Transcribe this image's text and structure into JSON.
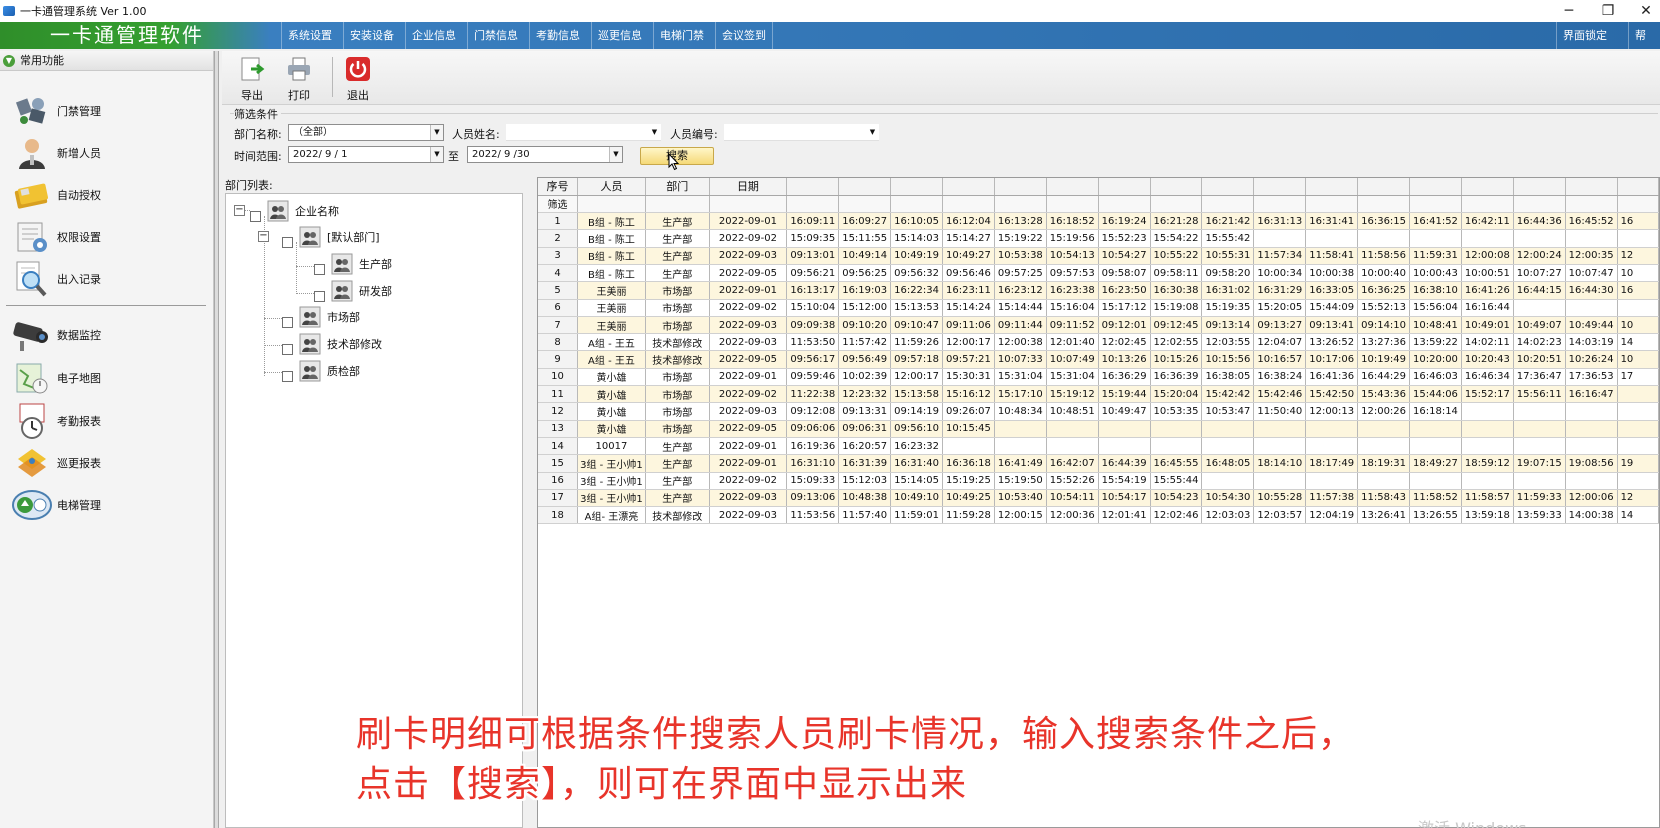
{
  "window": {
    "title": "一卡通管理系统  Ver 1.00",
    "controls": {
      "minimize": "─",
      "restore": "❐",
      "close": "✕"
    }
  },
  "menubar": {
    "brand": "一卡通管理软件",
    "items": [
      "系统设置",
      "安装设备",
      "企业信息",
      "门禁信息",
      "考勤信息",
      "巡更信息",
      "电梯门禁",
      "会议签到"
    ],
    "right_items": [
      "界面锁定",
      "帮助"
    ]
  },
  "sidebar": {
    "header": "常用功能",
    "group1": [
      {
        "label": "门禁管理",
        "icon": "door-access-icon"
      },
      {
        "label": "新增人员",
        "icon": "person-icon"
      },
      {
        "label": "自动授权",
        "icon": "card-icon"
      },
      {
        "label": "权限设置",
        "icon": "permission-icon"
      },
      {
        "label": "出入记录",
        "icon": "record-search-icon"
      }
    ],
    "group2": [
      {
        "label": "数据监控",
        "icon": "camera-icon"
      },
      {
        "label": "电子地图",
        "icon": "map-icon"
      },
      {
        "label": "考勤报表",
        "icon": "clock-icon"
      },
      {
        "label": "巡更报表",
        "icon": "patrol-icon"
      },
      {
        "label": "电梯管理",
        "icon": "elevator-icon"
      }
    ]
  },
  "toolbar": {
    "export": "导出",
    "print": "打印",
    "exit": "退出"
  },
  "filter": {
    "legend": "筛选条件",
    "dept_label": "部门名称:",
    "dept_value": "（全部）",
    "name_label": "人员姓名:",
    "name_value": "",
    "id_label": "人员编号:",
    "id_value": "",
    "time_label": "时间范围:",
    "date_from": "2022/ 9 / 1",
    "to_label": "至",
    "date_to": "2022/ 9 /30",
    "search_button": "搜索"
  },
  "dept_tree": {
    "label": "部门列表:",
    "root": "企业名称",
    "nodes": [
      "[默认部门]",
      "生产部",
      "研发部",
      "市场部",
      "技术部修改",
      "质检部"
    ]
  },
  "grid": {
    "headers": [
      "序号",
      "人员",
      "部门",
      "日期"
    ],
    "filter_row_label": "筛选",
    "rows": [
      {
        "no": "1",
        "person": "B组 - 陈工",
        "dept": "生产部",
        "date": "2022-09-01",
        "times": [
          "16:09:11",
          "16:09:27",
          "16:10:05",
          "16:12:04",
          "16:13:28",
          "16:18:52",
          "16:19:24",
          "16:21:28",
          "16:21:42",
          "16:31:13",
          "16:31:41",
          "16:36:15",
          "16:41:52",
          "16:42:11",
          "16:44:36",
          "16:45:52",
          "16"
        ]
      },
      {
        "no": "2",
        "person": "B组 - 陈工",
        "dept": "生产部",
        "date": "2022-09-02",
        "times": [
          "15:09:35",
          "15:11:55",
          "15:14:03",
          "15:14:27",
          "15:19:22",
          "15:19:56",
          "15:52:23",
          "15:54:22",
          "15:55:42"
        ]
      },
      {
        "no": "3",
        "person": "B组 - 陈工",
        "dept": "生产部",
        "date": "2022-09-03",
        "times": [
          "09:13:01",
          "10:49:14",
          "10:49:19",
          "10:49:27",
          "10:53:38",
          "10:54:13",
          "10:54:27",
          "10:55:22",
          "10:55:31",
          "11:57:34",
          "11:58:41",
          "11:58:56",
          "11:59:31",
          "12:00:08",
          "12:00:24",
          "12:00:35",
          "12"
        ]
      },
      {
        "no": "4",
        "person": "B组 - 陈工",
        "dept": "生产部",
        "date": "2022-09-05",
        "times": [
          "09:56:21",
          "09:56:25",
          "09:56:32",
          "09:56:46",
          "09:57:25",
          "09:57:53",
          "09:58:07",
          "09:58:11",
          "09:58:20",
          "10:00:34",
          "10:00:38",
          "10:00:40",
          "10:00:43",
          "10:00:51",
          "10:07:27",
          "10:07:47",
          "10"
        ]
      },
      {
        "no": "5",
        "person": "王美丽",
        "dept": "市场部",
        "date": "2022-09-01",
        "times": [
          "16:13:17",
          "16:19:03",
          "16:22:34",
          "16:23:11",
          "16:23:12",
          "16:23:38",
          "16:23:50",
          "16:30:38",
          "16:31:02",
          "16:31:29",
          "16:33:05",
          "16:36:25",
          "16:38:10",
          "16:41:26",
          "16:44:15",
          "16:44:30",
          "16"
        ]
      },
      {
        "no": "6",
        "person": "王美丽",
        "dept": "市场部",
        "date": "2022-09-02",
        "times": [
          "15:10:04",
          "15:12:00",
          "15:13:53",
          "15:14:24",
          "15:14:44",
          "15:16:04",
          "15:17:12",
          "15:19:08",
          "15:19:35",
          "15:20:05",
          "15:44:09",
          "15:52:13",
          "15:56:04",
          "16:16:44"
        ]
      },
      {
        "no": "7",
        "person": "王美丽",
        "dept": "市场部",
        "date": "2022-09-03",
        "times": [
          "09:09:38",
          "09:10:20",
          "09:10:47",
          "09:11:06",
          "09:11:44",
          "09:11:52",
          "09:12:01",
          "09:12:45",
          "09:13:14",
          "09:13:27",
          "09:13:41",
          "09:14:10",
          "10:48:41",
          "10:49:01",
          "10:49:07",
          "10:49:44",
          "10"
        ]
      },
      {
        "no": "8",
        "person": "A组 - 王五",
        "dept": "技术部修改",
        "date": "2022-09-03",
        "times": [
          "11:53:50",
          "11:57:42",
          "11:59:26",
          "12:00:17",
          "12:00:38",
          "12:01:40",
          "12:02:45",
          "12:02:55",
          "12:03:55",
          "12:04:07",
          "13:26:52",
          "13:27:36",
          "13:59:22",
          "14:02:11",
          "14:02:23",
          "14:03:19",
          "14"
        ]
      },
      {
        "no": "9",
        "person": "A组 - 王五",
        "dept": "技术部修改",
        "date": "2022-09-05",
        "times": [
          "09:56:17",
          "09:56:49",
          "09:57:18",
          "09:57:21",
          "10:07:33",
          "10:07:49",
          "10:13:26",
          "10:15:26",
          "10:15:56",
          "10:16:57",
          "10:17:06",
          "10:19:49",
          "10:20:00",
          "10:20:43",
          "10:20:51",
          "10:26:24",
          "10"
        ]
      },
      {
        "no": "10",
        "person": "黄小雄",
        "dept": "市场部",
        "date": "2022-09-01",
        "times": [
          "09:59:46",
          "10:02:39",
          "12:00:17",
          "15:30:31",
          "15:31:04",
          "15:31:04",
          "16:36:29",
          "16:36:39",
          "16:38:05",
          "16:38:24",
          "16:41:36",
          "16:44:29",
          "16:46:03",
          "16:46:34",
          "17:36:47",
          "17:36:53",
          "17"
        ]
      },
      {
        "no": "11",
        "person": "黄小雄",
        "dept": "市场部",
        "date": "2022-09-02",
        "times": [
          "11:22:38",
          "12:23:32",
          "15:13:58",
          "15:16:12",
          "15:17:10",
          "15:19:12",
          "15:19:44",
          "15:20:04",
          "15:42:42",
          "15:42:46",
          "15:42:50",
          "15:43:36",
          "15:44:06",
          "15:52:17",
          "15:56:11",
          "16:16:47"
        ]
      },
      {
        "no": "12",
        "person": "黄小雄",
        "dept": "市场部",
        "date": "2022-09-03",
        "times": [
          "09:12:08",
          "09:13:31",
          "09:14:19",
          "09:26:07",
          "10:48:34",
          "10:48:51",
          "10:49:47",
          "10:53:35",
          "10:53:47",
          "11:50:40",
          "12:00:13",
          "12:00:26",
          "16:18:14"
        ]
      },
      {
        "no": "13",
        "person": "黄小雄",
        "dept": "市场部",
        "date": "2022-09-05",
        "times": [
          "09:06:06",
          "09:06:31",
          "09:56:10",
          "10:15:45"
        ]
      },
      {
        "no": "14",
        "person": "10017",
        "dept": "生产部",
        "date": "2022-09-01",
        "times": [
          "16:19:36",
          "16:20:57",
          "16:23:32"
        ]
      },
      {
        "no": "15",
        "person": "3组 - 王小帅1",
        "dept": "生产部",
        "date": "2022-09-01",
        "times": [
          "16:31:10",
          "16:31:39",
          "16:31:40",
          "16:36:18",
          "16:41:49",
          "16:42:07",
          "16:44:39",
          "16:45:55",
          "16:48:05",
          "18:14:10",
          "18:17:49",
          "18:19:31",
          "18:49:27",
          "18:59:12",
          "19:07:15",
          "19:08:56",
          "19"
        ]
      },
      {
        "no": "16",
        "person": "3组 - 王小帅1",
        "dept": "生产部",
        "date": "2022-09-02",
        "times": [
          "15:09:33",
          "15:12:03",
          "15:14:05",
          "15:19:25",
          "15:19:50",
          "15:52:26",
          "15:54:19",
          "15:55:44"
        ]
      },
      {
        "no": "17",
        "person": "3组 - 王小帅1",
        "dept": "生产部",
        "date": "2022-09-03",
        "times": [
          "09:13:06",
          "10:48:38",
          "10:49:10",
          "10:49:25",
          "10:53:40",
          "10:54:11",
          "10:54:17",
          "10:54:23",
          "10:54:30",
          "10:55:28",
          "11:57:38",
          "11:58:43",
          "11:58:52",
          "11:58:57",
          "11:59:33",
          "12:00:06",
          "12"
        ]
      },
      {
        "no": "18",
        "person": "A组- 王漂亮",
        "dept": "技术部修改",
        "date": "2022-09-03",
        "times": [
          "11:53:56",
          "11:57:40",
          "11:59:01",
          "11:59:28",
          "12:00:15",
          "12:00:36",
          "12:01:41",
          "12:02:46",
          "12:03:03",
          "12:03:57",
          "12:04:19",
          "13:26:41",
          "13:26:55",
          "13:59:18",
          "13:59:33",
          "14:00:38",
          "14"
        ]
      }
    ]
  },
  "caption": {
    "line1": "刷卡明细可根据条件搜索人员刷卡情况，输入搜索条件之后，",
    "line2": "点击【搜索】，则可在界面中显示出来"
  },
  "watermark": "激活 Windows"
}
